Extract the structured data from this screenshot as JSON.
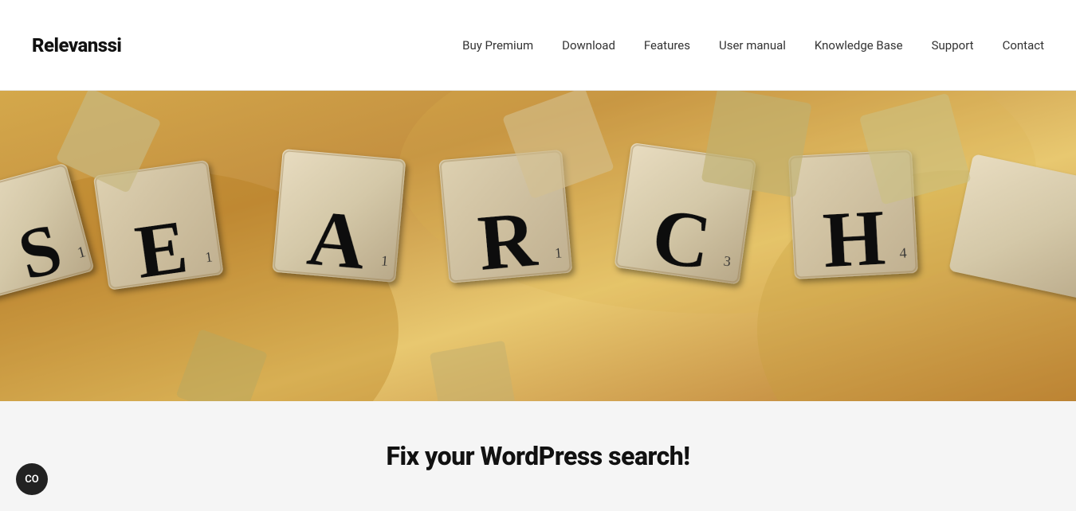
{
  "header": {
    "logo": "Relevanssi",
    "nav": {
      "items": [
        {
          "label": "Buy Premium",
          "id": "buy-premium"
        },
        {
          "label": "Download",
          "id": "download"
        },
        {
          "label": "Features",
          "id": "features"
        },
        {
          "label": "User manual",
          "id": "user-manual"
        },
        {
          "label": "Knowledge Base",
          "id": "knowledge-base"
        },
        {
          "label": "Support",
          "id": "support"
        },
        {
          "label": "Contact",
          "id": "contact"
        }
      ]
    }
  },
  "hero": {
    "alt": "Scrabble tiles spelling SEARCH"
  },
  "content": {
    "headline": "Fix your WordPress search!"
  },
  "floating_button": {
    "label": "CO"
  }
}
